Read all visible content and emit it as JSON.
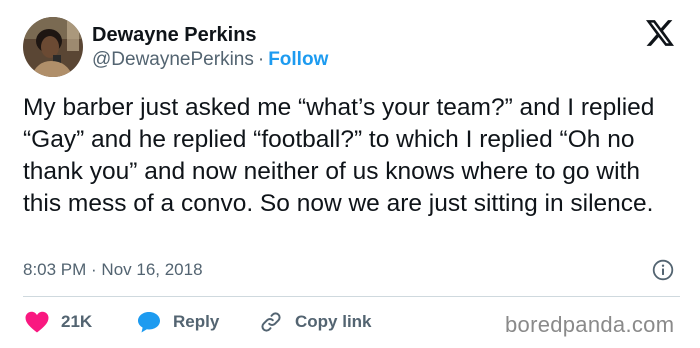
{
  "author": {
    "name": "Dewayne Perkins",
    "handle": "@DewaynePerkins",
    "separator": "·",
    "follow_label": "Follow"
  },
  "tweet": {
    "text": "My barber just asked me “what’s your team?” and I replied “Gay” and he replied “football?” to which I replied “Oh no thank you” and now neither of us knows where to go with this mess of a convo. So now we are just sitting in silence.",
    "timestamp": "8:03 PM · Nov 16, 2018"
  },
  "actions": {
    "like_count": "21K",
    "reply_label": "Reply",
    "copy_label": "Copy link"
  },
  "watermark": "boredpanda.com",
  "icons": {
    "logo": "x-logo-icon",
    "info": "info-icon",
    "like": "heart-icon",
    "reply": "speech-bubble-icon",
    "copy": "link-icon"
  },
  "colors": {
    "text": "#0f1419",
    "secondary": "#536471",
    "accent": "#1d9bf0",
    "like": "#f91880",
    "divider": "#cfd9de"
  }
}
